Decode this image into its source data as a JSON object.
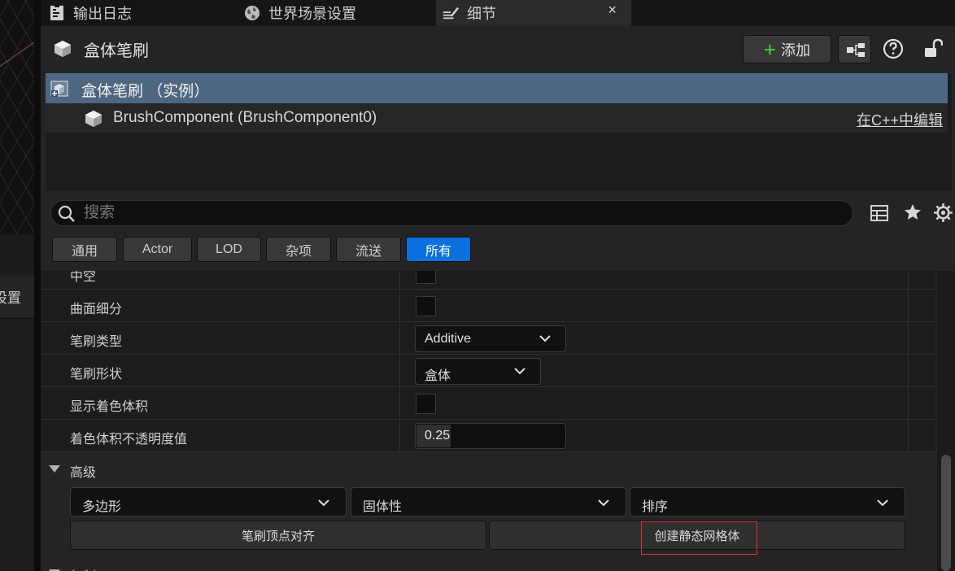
{
  "left_side": {
    "tab_label": "设置"
  },
  "tabs": [
    {
      "label": "输出日志",
      "icon": "output-log-icon"
    },
    {
      "label": "世界场景设置",
      "icon": "globe-icon"
    },
    {
      "label": "细节",
      "icon": "details-icon",
      "active": true
    }
  ],
  "tab_close": "×",
  "header": {
    "title": "盒体笔刷",
    "add_label": "添加",
    "add_icon": "plus-icon",
    "blueprint_icon": "blueprint-icon",
    "help_icon": "help-icon",
    "lock_icon": "lock-icon"
  },
  "component_tree": {
    "root": "盒体笔刷 （实例）",
    "child": "BrushComponent (BrushComponent0)",
    "edit_link": "在C++中编辑"
  },
  "search": {
    "placeholder": "搜索",
    "value": ""
  },
  "filters": [
    "通用",
    "Actor",
    "LOD",
    "杂项",
    "流送",
    "所有"
  ],
  "active_filter": "所有",
  "properties": [
    {
      "name": "中空",
      "type": "checkbox",
      "checked": false
    },
    {
      "name": "曲面细分",
      "type": "checkbox",
      "checked": false
    },
    {
      "name": "笔刷类型",
      "type": "combo",
      "value": "Additive"
    },
    {
      "name": "笔刷形状",
      "type": "combo",
      "value": "盒体"
    },
    {
      "name": "显示着色体积",
      "type": "checkbox",
      "checked": false
    },
    {
      "name": "着色体积不透明度值",
      "type": "number",
      "value": "0.25"
    }
  ],
  "advanced": {
    "title": "高级",
    "combos": [
      "多边形",
      "固体性",
      "排序"
    ],
    "buttons": [
      "笔刷顶点对齐",
      "创建静态网格体"
    ]
  },
  "next_section": "复制",
  "colors": {
    "accent": "#0a70e0",
    "selection": "#4d6782",
    "add_plus": "#4ec94a",
    "focus": "#dd3333"
  }
}
